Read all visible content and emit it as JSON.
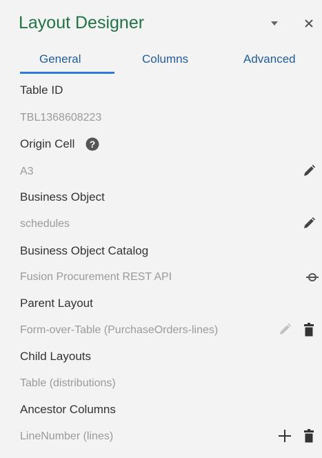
{
  "header": {
    "title": "Layout Designer",
    "dropdown_icon": "chevron-down-icon",
    "close_icon": "close-icon"
  },
  "tabs": [
    {
      "label": "General",
      "active": true
    },
    {
      "label": "Columns",
      "active": false
    },
    {
      "label": "Advanced",
      "active": false
    }
  ],
  "fields": {
    "table_id": {
      "label": "Table ID",
      "value": "TBL1368608223"
    },
    "origin_cell": {
      "label": "Origin Cell",
      "value": "A3",
      "help_icon": "help-icon",
      "action_icon": "edit-pencil-icon"
    },
    "business_object": {
      "label": "Business Object",
      "value": "schedules",
      "action_icon": "edit-pencil-icon"
    },
    "business_object_catalog": {
      "label": "Business Object Catalog",
      "value": "Fusion Procurement REST API",
      "action_icon": "catalog-info-icon"
    },
    "parent_layout": {
      "label": "Parent Layout",
      "value": "Form-over-Table (PurchaseOrders-lines)",
      "action_icons": [
        "edit-pencil-icon",
        "trash-icon"
      ]
    },
    "child_layouts": {
      "label": "Child Layouts",
      "value": "Table (distributions)"
    },
    "ancestor_columns": {
      "label": "Ancestor Columns",
      "value": "LineNumber (lines)",
      "action_icons": [
        "add-icon",
        "trash-icon"
      ]
    }
  },
  "colors": {
    "title": "#217346",
    "tab_text": "#1f5c99",
    "tab_underline": "#2d7bd6",
    "background": "#f3f3f3"
  }
}
